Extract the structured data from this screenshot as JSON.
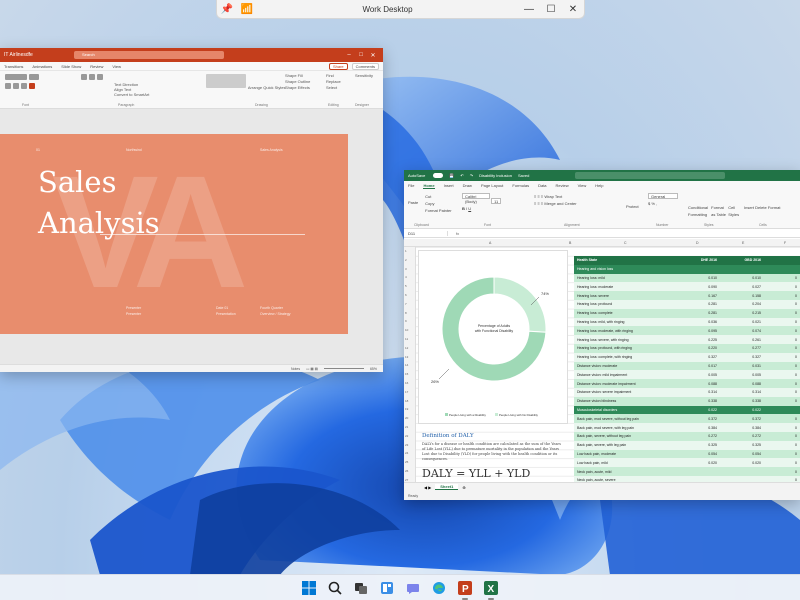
{
  "desktop": {
    "snap_title": "Work Desktop"
  },
  "powerpoint": {
    "doc_name": "IT Airlinesdfe",
    "search_placeholder": "Search",
    "menu": [
      "Transitions",
      "Animations",
      "Slide Show",
      "Review",
      "View"
    ],
    "share_label": "Share",
    "comments_label": "Comments",
    "ribbon_groups": [
      "Font",
      "Paragraph",
      "Drawing",
      "Editing",
      "Designer",
      "Protection"
    ],
    "ribbon_items": [
      "Text Direction",
      "Align Text",
      "Convert to SmartArt",
      "Shape Fill",
      "Shape Outline",
      "Shape Effects",
      "Find",
      "Replace",
      "Select",
      "Arrange",
      "Quick Styles",
      "Sensitivity"
    ],
    "slide": {
      "title_line1": "Sales",
      "title_line2": "Analysis",
      "bg_letters": "VA",
      "top_left": "01",
      "top_mid": "Northwind",
      "top_right": "Sales Analysis",
      "bottom_1a": "Presenter",
      "bottom_1b": "Presenter",
      "bottom_2a": "Date 01",
      "bottom_2b": "Presentation",
      "bottom_3a": "Fourth Quarter",
      "bottom_3b": "Overview / Strategy"
    },
    "status": {
      "notes": "Notes",
      "zoom": "65%"
    }
  },
  "excel": {
    "autosave": "AutoSave",
    "file_name": "Disability Inclusion",
    "saved": "Saved",
    "menu": [
      "File",
      "Home",
      "Insert",
      "Draw",
      "Page Layout",
      "Formulas",
      "Data",
      "Review",
      "View",
      "Help"
    ],
    "active_tab": "Home",
    "ribbon": {
      "paste": "Paste",
      "cut": "Cut",
      "copy": "Copy",
      "format_painter": "Format Painter",
      "font": "Calibri (Body)",
      "font_size": "11",
      "wrap": "Wrap Text",
      "merge": "Merge and Center",
      "number_format": "General",
      "protect": "Protect",
      "cond_fmt": "Conditional Formatting",
      "fmt_table": "Format as Table",
      "cell_styles": "Cell Styles",
      "insert": "Insert",
      "delete": "Delete",
      "format": "Format",
      "clipboard_label": "Clipboard",
      "font_label": "Font",
      "alignment_label": "Alignment",
      "number_label": "Number",
      "styles_label": "Styles",
      "cells_label": "Cells"
    },
    "name_box": "D11",
    "fx": "fx",
    "columns": [
      "A",
      "B",
      "C",
      "D",
      "E",
      "F"
    ],
    "chart": {
      "center_label": "Percentage of Adults with Functional Disability",
      "pct_large": "74%",
      "pct_small": "26%",
      "legend_a": "People Living with a Disability",
      "legend_b": "People Living with No Disability",
      "slices": [
        26,
        74
      ],
      "colors": [
        "#c8ecd5",
        "#9fd9b6"
      ]
    },
    "definition": {
      "heading": "Definition of DALY",
      "body": "DALYs for a disease or health condition are calculated as the sum of the Years of Life Lost (YLL) due to premature mortality in the population and the Years Lost due to Disability (YLD) for people living with the health condition or its consequences.",
      "formula": "DALY = YLL + YLD"
    },
    "table": {
      "headers": [
        "Health State",
        "DHE 2016",
        "GBD 2016",
        ""
      ],
      "rows": [
        {
          "type": "cat",
          "c": [
            "Hearing and vision loss",
            "",
            "",
            ""
          ]
        },
        {
          "type": "lt",
          "c": [
            "Hearing loss: mild",
            "0.010",
            "0.010",
            "0"
          ]
        },
        {
          "type": "wt",
          "c": [
            "Hearing loss: moderate",
            "0.090",
            "0.027",
            "0"
          ]
        },
        {
          "type": "lt",
          "c": [
            "Hearing loss: severe",
            "0.167",
            "0.158",
            "0"
          ]
        },
        {
          "type": "wt",
          "c": [
            "Hearing loss: profound",
            "0.281",
            "0.204",
            "0"
          ]
        },
        {
          "type": "lt",
          "c": [
            "Hearing loss: complete",
            "0.281",
            "0.215",
            "0"
          ]
        },
        {
          "type": "wt",
          "c": [
            "Hearing loss: mild, with ringing",
            "0.036",
            "0.021",
            "0"
          ]
        },
        {
          "type": "lt",
          "c": [
            "Hearing loss: moderate, with ringing",
            "0.095",
            "0.074",
            "0"
          ]
        },
        {
          "type": "wt",
          "c": [
            "Hearing loss: severe, with ringing",
            "0.225",
            "0.261",
            "0"
          ]
        },
        {
          "type": "lt",
          "c": [
            "Hearing loss: profound, with ringing",
            "0.220",
            "0.277",
            "0"
          ]
        },
        {
          "type": "wt",
          "c": [
            "Hearing loss: complete, with ringing",
            "0.327",
            "0.327",
            "0"
          ]
        },
        {
          "type": "lt",
          "c": [
            "Distance vision: moderate",
            "0.017",
            "0.031",
            "0"
          ]
        },
        {
          "type": "wt",
          "c": [
            "Distance vision: mild impairment",
            "0.005",
            "0.005",
            "0"
          ]
        },
        {
          "type": "lt",
          "c": [
            "Distance vision: moderate impairment",
            "0.088",
            "0.088",
            "0"
          ]
        },
        {
          "type": "wt",
          "c": [
            "Distance vision: severe impairment",
            "0.314",
            "0.314",
            "0"
          ]
        },
        {
          "type": "lt",
          "c": [
            "Distance vision blindness",
            "0.338",
            "0.338",
            "0"
          ]
        },
        {
          "type": "cat",
          "c": [
            "Musculoskeletal disorders",
            "0.022",
            "0.022",
            ""
          ]
        },
        {
          "type": "lt",
          "c": [
            "Back pain, mod severe, without leg pain",
            "0.372",
            "0.372",
            "0"
          ]
        },
        {
          "type": "wt",
          "c": [
            "Back pain, mod severe, with leg pain",
            "0.384",
            "0.384",
            "0"
          ]
        },
        {
          "type": "lt",
          "c": [
            "Back pain, severe, without leg pain",
            "0.272",
            "0.272",
            "0"
          ]
        },
        {
          "type": "wt",
          "c": [
            "Back pain, severe, with leg pain",
            "0.325",
            "0.325",
            "0"
          ]
        },
        {
          "type": "lt",
          "c": [
            "Low back pain, moderate",
            "0.054",
            "0.054",
            "0"
          ]
        },
        {
          "type": "wt",
          "c": [
            "Low back pain, mild",
            "0.020",
            "0.020",
            "0"
          ]
        },
        {
          "type": "lt",
          "c": [
            "Neck pain, acute, mild",
            "",
            "",
            "0"
          ]
        },
        {
          "type": "wt",
          "c": [
            "Neck pain, acute, severe",
            "",
            "",
            "0"
          ]
        },
        {
          "type": "lt",
          "c": [
            "Neck pain, chronic, mild",
            "",
            "",
            "0"
          ]
        },
        {
          "type": "wt",
          "c": [
            "Neck pain, chronic, severe",
            "",
            "",
            "0"
          ]
        },
        {
          "type": "lt",
          "c": [
            "Neck pain, mild",
            "0.053",
            "0.053",
            "0"
          ]
        },
        {
          "type": "wt",
          "c": [
            "Neck pain, moderate",
            "0.114",
            "0.114",
            "0"
          ]
        },
        {
          "type": "lt",
          "c": [
            "Neck pain, severe",
            "0.229",
            "0.229",
            "0"
          ]
        }
      ]
    },
    "sheet_tab": "Sheet1",
    "status": "Ready"
  },
  "taskbar": {
    "items": [
      "start-icon",
      "search-icon",
      "task-view-icon",
      "widgets-icon",
      "teams-chat-icon",
      "edge-icon",
      "powerpoint-icon",
      "excel-icon"
    ]
  },
  "colors": {
    "ppt_accent": "#c43e1c",
    "xls_accent": "#217346",
    "slide_bg": "#e88d6d"
  }
}
